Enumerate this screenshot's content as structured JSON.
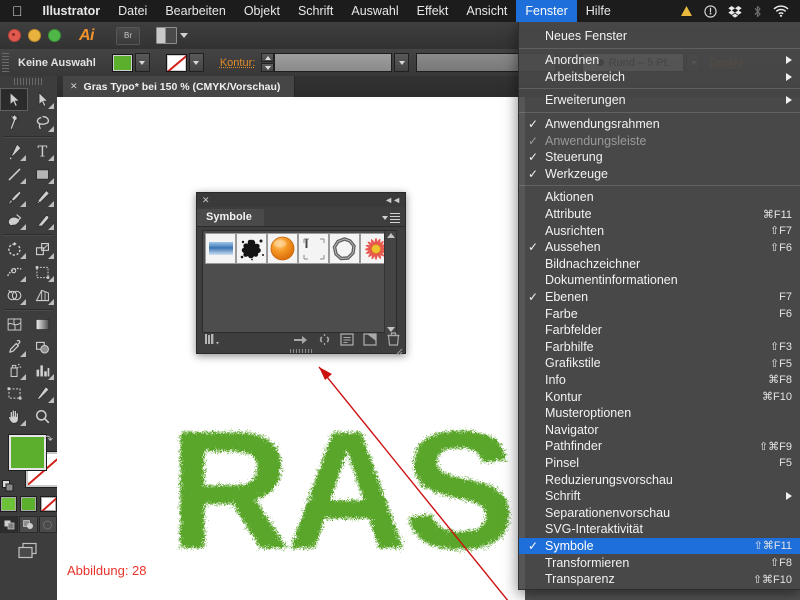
{
  "macmenu": {
    "apple_icon": "apple-icon",
    "items": [
      {
        "label": "Illustrator",
        "bold": true,
        "active": false
      },
      {
        "label": "Datei",
        "bold": false,
        "active": false
      },
      {
        "label": "Bearbeiten",
        "bold": false,
        "active": false
      },
      {
        "label": "Objekt",
        "bold": false,
        "active": false
      },
      {
        "label": "Schrift",
        "bold": false,
        "active": false
      },
      {
        "label": "Auswahl",
        "bold": false,
        "active": false
      },
      {
        "label": "Effekt",
        "bold": false,
        "active": false
      },
      {
        "label": "Ansicht",
        "bold": false,
        "active": false
      },
      {
        "label": "Fenster",
        "bold": false,
        "active": true
      },
      {
        "label": "Hilfe",
        "bold": false,
        "active": false
      }
    ],
    "status_icons": [
      "warning-triangle-icon",
      "clock-icon",
      "dropbox-icon",
      "bluetooth-icon",
      "wifi-icon"
    ]
  },
  "appbar": {
    "logo": "Ai",
    "bridge_button": "Br",
    "arrange_button": "arrange-documents-icon"
  },
  "controlbar": {
    "selection_label": "Keine Auswahl",
    "fill_color": "#5caf2d",
    "stroke_color": "none",
    "stroke_label": "Kontur:",
    "stroke_weight": "",
    "stroke_profile": "",
    "brush_definition": "Rund – 5 Pt.",
    "opacity_label": "Deckkr"
  },
  "toolbox": {
    "tools": [
      "selection-tool",
      "direct-selection-tool",
      "magic-wand-tool",
      "lasso-tool",
      "pen-tool",
      "type-tool",
      "line-segment-tool",
      "rectangle-tool",
      "paintbrush-tool",
      "pencil-tool",
      "blob-brush-tool",
      "eraser-tool",
      "rotate-tool",
      "scale-tool",
      "width-tool",
      "free-transform-tool",
      "shape-builder-tool",
      "perspective-grid-tool",
      "mesh-tool",
      "gradient-tool",
      "eyedropper-tool",
      "blend-tool",
      "symbol-sprayer-tool",
      "column-graph-tool",
      "artboard-tool",
      "slice-tool",
      "hand-tool",
      "zoom-tool"
    ],
    "selected_tool": "selection-tool",
    "fill_swatch": "#5caf2d",
    "stroke_swatch": "none",
    "mini_swatches": [
      "#6ec23a",
      "#5caf2d",
      "none"
    ],
    "draw_modes": [
      "draw-normal",
      "draw-behind",
      "draw-inside"
    ],
    "screen_mode": "screen-mode-icon"
  },
  "document": {
    "tab_title": "Gras Typo* bei 150 % (CMYK/Vorschau)",
    "close_icon": "close-icon",
    "caption": "Abbildung: 28",
    "artwork_text": "RAS",
    "artwork_color": "#5aa62c"
  },
  "symbols_panel": {
    "title": "Symbole",
    "close_icon": "close-icon",
    "collapse_icon": "collapse-icon",
    "menu_icon": "panel-menu-icon",
    "symbols": [
      {
        "name": "symbol-blue-gradient-bar"
      },
      {
        "name": "symbol-black-splatter"
      },
      {
        "name": "symbol-orange-sphere"
      },
      {
        "name": "symbol-corner-marks"
      },
      {
        "name": "symbol-grey-ring"
      },
      {
        "name": "symbol-red-flower"
      }
    ],
    "footer_icons": [
      "symbol-libraries-icon",
      "place-symbol-instance-icon",
      "break-link-icon",
      "symbol-options-icon",
      "new-symbol-icon",
      "delete-symbol-icon"
    ]
  },
  "fenster_menu": {
    "title": "Fenster",
    "groups": [
      {
        "items": [
          {
            "label": "Neues Fenster",
            "shortcut": "",
            "checked": false,
            "submenu": false,
            "disabled": false,
            "highlighted": false
          }
        ]
      },
      {
        "items": [
          {
            "label": "Anordnen",
            "shortcut": "",
            "checked": false,
            "submenu": true,
            "disabled": false,
            "highlighted": false
          },
          {
            "label": "Arbeitsbereich",
            "shortcut": "",
            "checked": false,
            "submenu": true,
            "disabled": false,
            "highlighted": false
          }
        ]
      },
      {
        "items": [
          {
            "label": "Erweiterungen",
            "shortcut": "",
            "checked": false,
            "submenu": true,
            "disabled": false,
            "highlighted": false
          }
        ]
      },
      {
        "items": [
          {
            "label": "Anwendungsrahmen",
            "shortcut": "",
            "checked": true,
            "submenu": false,
            "disabled": false,
            "highlighted": false
          },
          {
            "label": "Anwendungsleiste",
            "shortcut": "",
            "checked": true,
            "submenu": false,
            "disabled": true,
            "highlighted": false
          },
          {
            "label": "Steuerung",
            "shortcut": "",
            "checked": true,
            "submenu": false,
            "disabled": false,
            "highlighted": false
          },
          {
            "label": "Werkzeuge",
            "shortcut": "",
            "checked": true,
            "submenu": false,
            "disabled": false,
            "highlighted": false
          }
        ]
      },
      {
        "items": [
          {
            "label": "Aktionen",
            "shortcut": "",
            "checked": false,
            "submenu": false,
            "disabled": false,
            "highlighted": false
          },
          {
            "label": "Attribute",
            "shortcut": "⌘F11",
            "checked": false,
            "submenu": false,
            "disabled": false,
            "highlighted": false
          },
          {
            "label": "Ausrichten",
            "shortcut": "⇧F7",
            "checked": false,
            "submenu": false,
            "disabled": false,
            "highlighted": false
          },
          {
            "label": "Aussehen",
            "shortcut": "⇧F6",
            "checked": true,
            "submenu": false,
            "disabled": false,
            "highlighted": false
          },
          {
            "label": "Bildnachzeichner",
            "shortcut": "",
            "checked": false,
            "submenu": false,
            "disabled": false,
            "highlighted": false
          },
          {
            "label": "Dokumentinformationen",
            "shortcut": "",
            "checked": false,
            "submenu": false,
            "disabled": false,
            "highlighted": false
          },
          {
            "label": "Ebenen",
            "shortcut": "F7",
            "checked": true,
            "submenu": false,
            "disabled": false,
            "highlighted": false
          },
          {
            "label": "Farbe",
            "shortcut": "F6",
            "checked": false,
            "submenu": false,
            "disabled": false,
            "highlighted": false
          },
          {
            "label": "Farbfelder",
            "shortcut": "",
            "checked": false,
            "submenu": false,
            "disabled": false,
            "highlighted": false
          },
          {
            "label": "Farbhilfe",
            "shortcut": "⇧F3",
            "checked": false,
            "submenu": false,
            "disabled": false,
            "highlighted": false
          },
          {
            "label": "Grafikstile",
            "shortcut": "⇧F5",
            "checked": false,
            "submenu": false,
            "disabled": false,
            "highlighted": false
          },
          {
            "label": "Info",
            "shortcut": "⌘F8",
            "checked": false,
            "submenu": false,
            "disabled": false,
            "highlighted": false
          },
          {
            "label": "Kontur",
            "shortcut": "⌘F10",
            "checked": false,
            "submenu": false,
            "disabled": false,
            "highlighted": false
          },
          {
            "label": "Musteroptionen",
            "shortcut": "",
            "checked": false,
            "submenu": false,
            "disabled": false,
            "highlighted": false
          },
          {
            "label": "Navigator",
            "shortcut": "",
            "checked": false,
            "submenu": false,
            "disabled": false,
            "highlighted": false
          },
          {
            "label": "Pathfinder",
            "shortcut": "⇧⌘F9",
            "checked": false,
            "submenu": false,
            "disabled": false,
            "highlighted": false
          },
          {
            "label": "Pinsel",
            "shortcut": "F5",
            "checked": false,
            "submenu": false,
            "disabled": false,
            "highlighted": false
          },
          {
            "label": "Reduzierungsvorschau",
            "shortcut": "",
            "checked": false,
            "submenu": false,
            "disabled": false,
            "highlighted": false
          },
          {
            "label": "Schrift",
            "shortcut": "",
            "checked": false,
            "submenu": true,
            "disabled": false,
            "highlighted": false
          },
          {
            "label": "Separationenvorschau",
            "shortcut": "",
            "checked": false,
            "submenu": false,
            "disabled": false,
            "highlighted": false
          },
          {
            "label": "SVG-Interaktivität",
            "shortcut": "",
            "checked": false,
            "submenu": false,
            "disabled": false,
            "highlighted": false
          },
          {
            "label": "Symbole",
            "shortcut": "⇧⌘F11",
            "checked": true,
            "submenu": false,
            "disabled": false,
            "highlighted": true
          },
          {
            "label": "Transformieren",
            "shortcut": "⇧F8",
            "checked": false,
            "submenu": false,
            "disabled": false,
            "highlighted": false
          },
          {
            "label": "Transparenz",
            "shortcut": "⇧⌘F10",
            "checked": false,
            "submenu": false,
            "disabled": false,
            "highlighted": false
          }
        ]
      }
    ],
    "highlight_color": "#1e6fd9"
  }
}
